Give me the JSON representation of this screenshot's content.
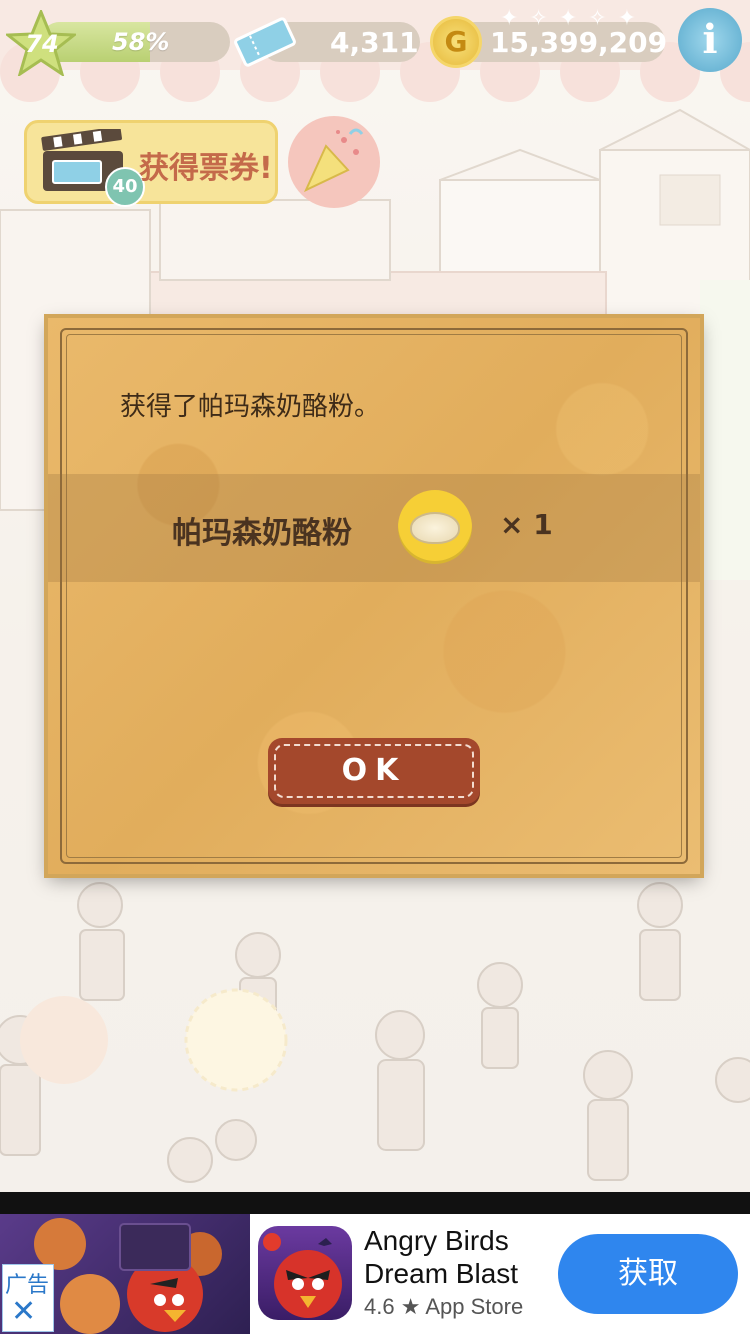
{
  "hud": {
    "level": "74",
    "xp_percent_label": "58%",
    "xp_progress": 0.58,
    "tickets": "4,311",
    "coin_symbol": "G",
    "coins": "15,399,209",
    "info_label": "i"
  },
  "promo": {
    "ticket_badge": "40",
    "get_tickets_label": "获得票券!"
  },
  "dialog": {
    "message": "获得了帕玛森奶酪粉。",
    "item_name": "帕玛森奶酪粉",
    "item_icon": "parmesan-powder-icon",
    "item_quantity": "× 1",
    "ok_label": "OK"
  },
  "ad": {
    "ad_tag": "广告",
    "close_glyph": "✕",
    "app_title_line1": "Angry Birds",
    "app_title_line2": "Dream Blast",
    "rating": "4.6",
    "rating_star": "★",
    "store": "App Store",
    "get_label": "获取"
  },
  "colors": {
    "dialog_paper": "#e7b668",
    "ok_button": "#a4482c",
    "get_button": "#2f86ee",
    "coin": "#f6cf36"
  }
}
